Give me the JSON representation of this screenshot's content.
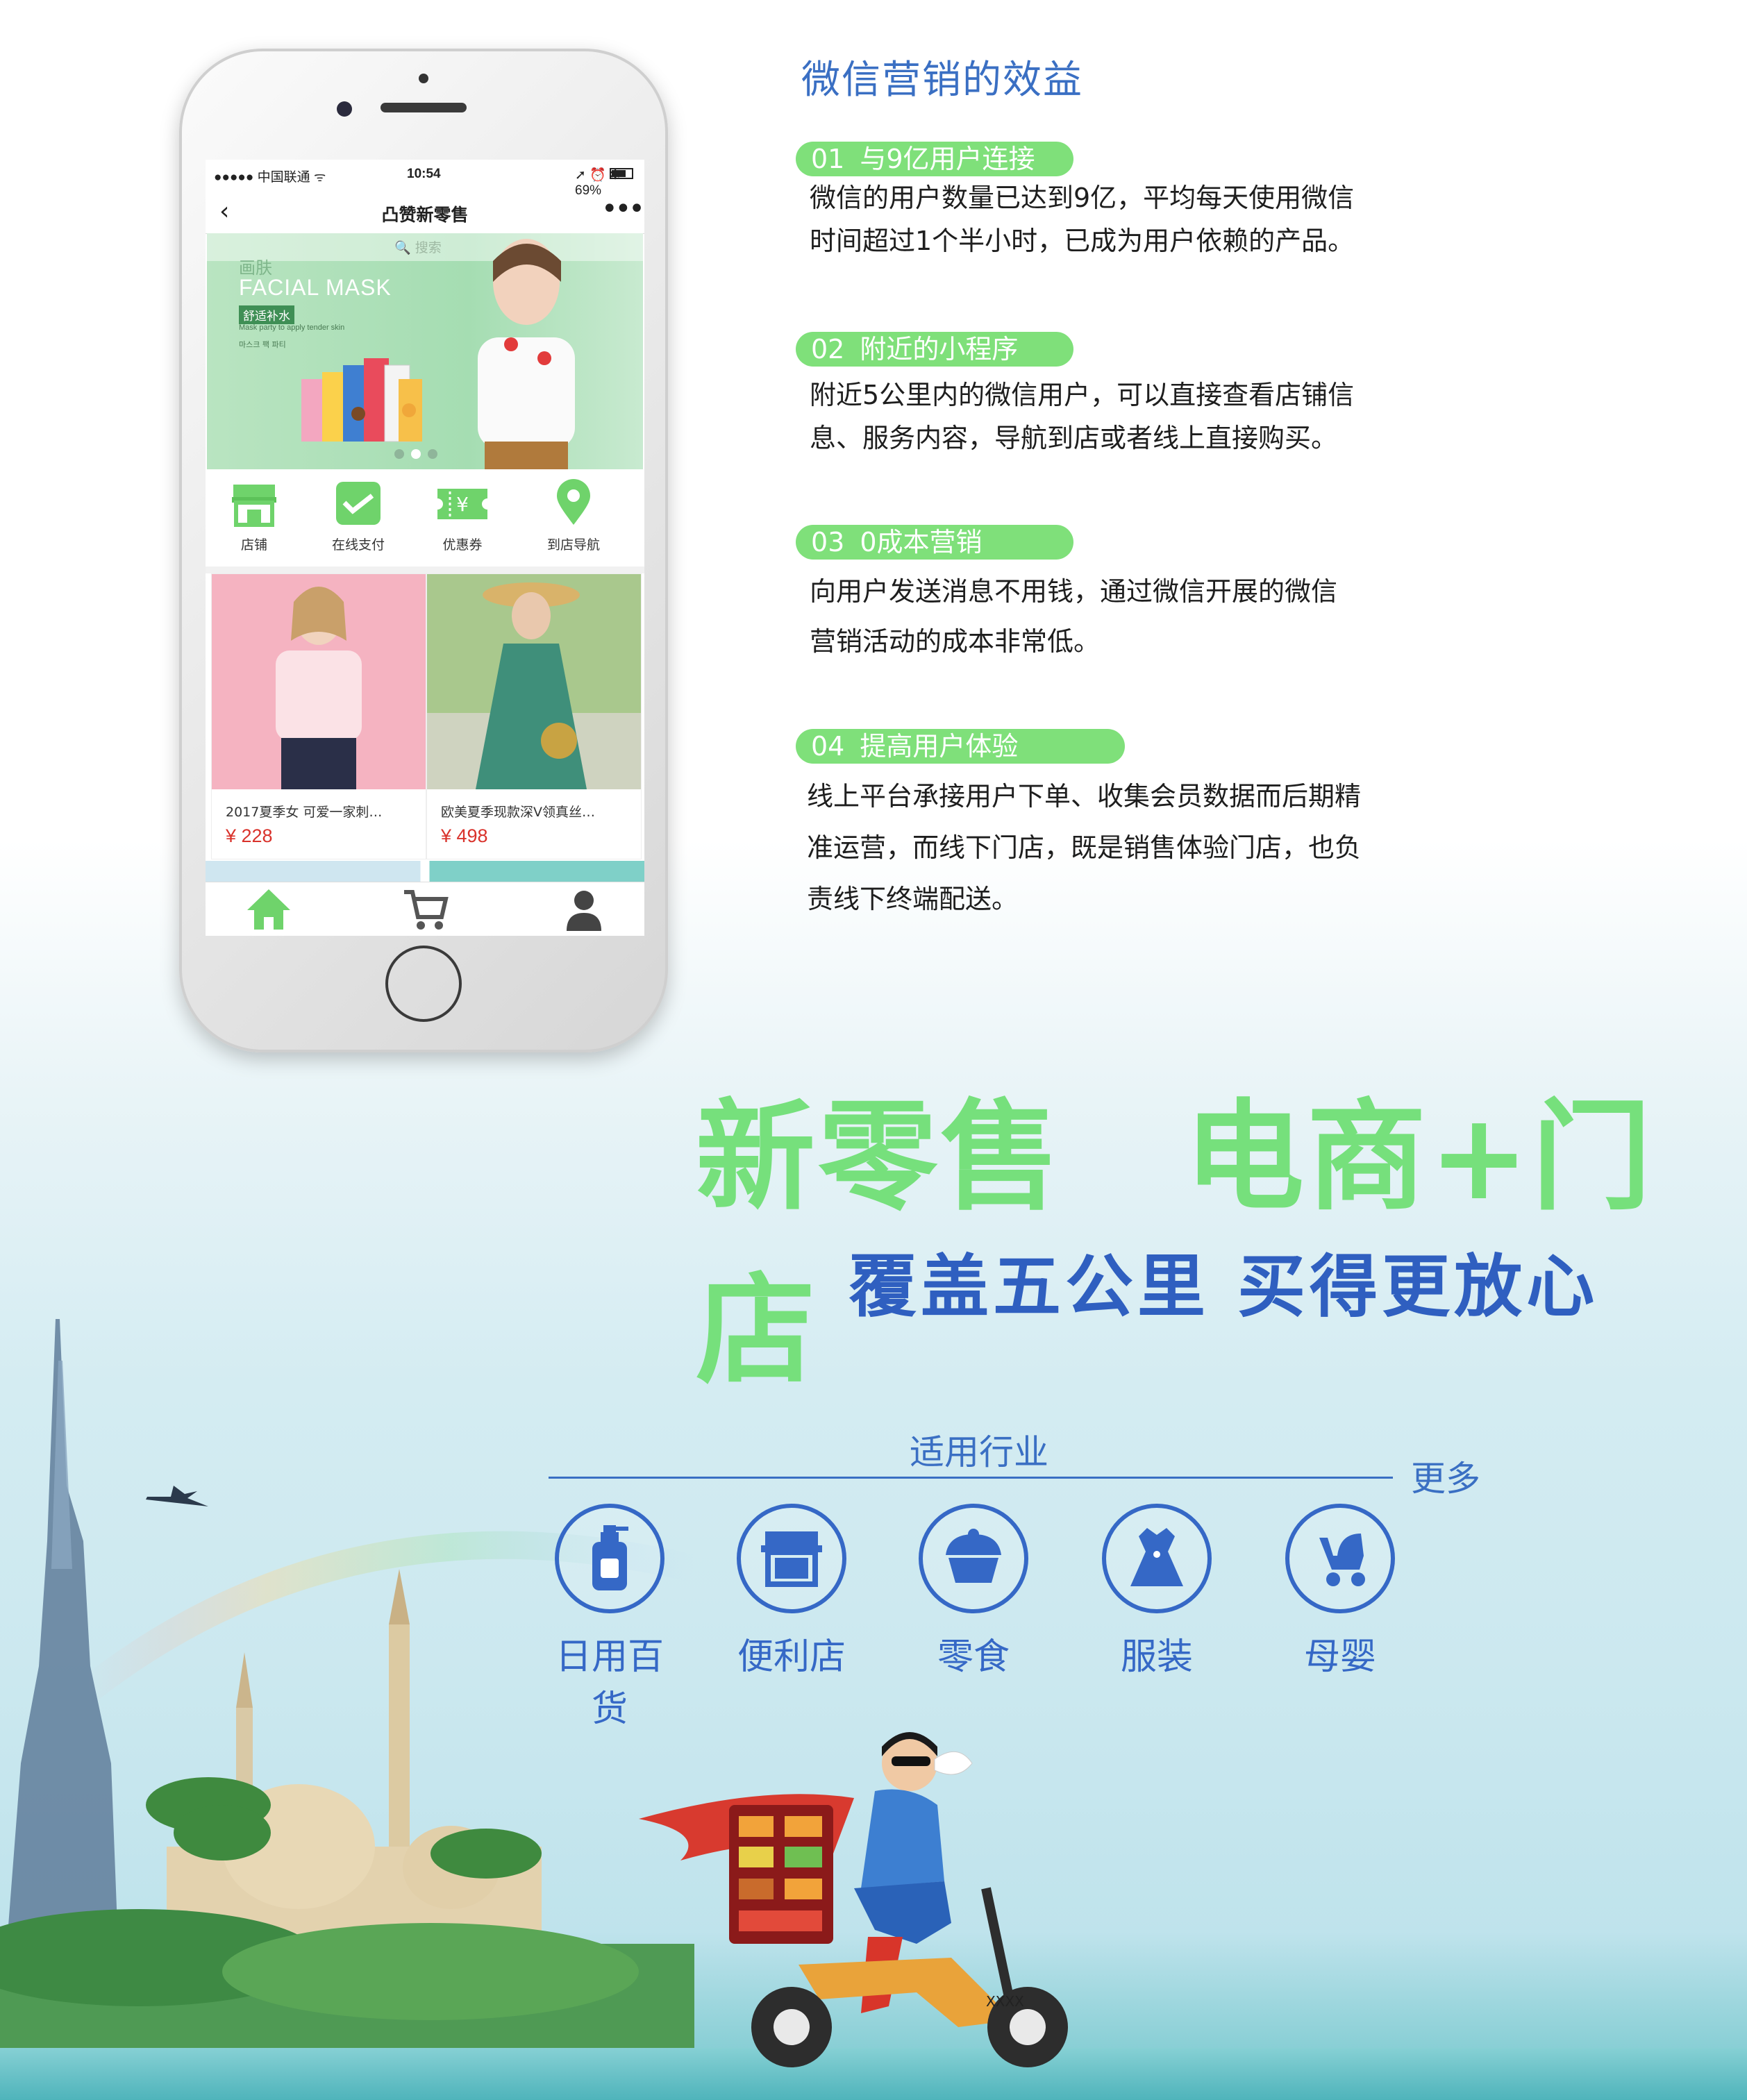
{
  "phone": {
    "status": {
      "carrier": "●●●●● 中国联通 ᯤ",
      "time": "10:54",
      "battery": "➚ ⏰ ✻ 69%"
    },
    "nav": {
      "title": "凸赞新零售",
      "back": "‹",
      "more": "•••"
    },
    "search_placeholder": "🔍 搜索",
    "banner": {
      "brand": "画肤",
      "title": "FACIAL MASK",
      "tag": "舒适补水",
      "sub": "Mask party to apply tender skin",
      "sub2": "마스크 팩 파티"
    },
    "quick_menu": [
      {
        "label": "店铺",
        "icon": "store-icon"
      },
      {
        "label": "在线支付",
        "icon": "wechat-pay-icon"
      },
      {
        "label": "优惠券",
        "icon": "coupon-icon"
      },
      {
        "label": "到店导航",
        "icon": "location-pin-icon"
      }
    ],
    "products": [
      {
        "title": "2017夏季女 可爱一家刺…",
        "price": "¥ 228"
      },
      {
        "title": "欧美夏季现款深V领真丝…",
        "price": "¥ 498"
      }
    ],
    "tabs": [
      "home-tab-icon",
      "cart-tab-icon",
      "profile-tab-icon"
    ],
    "accent": "#6fd36b"
  },
  "benefits": {
    "title": "微信营销的效益",
    "items": [
      {
        "num": "01",
        "title": "与9亿用户连接",
        "lines": [
          "微信的用户数量已达到9亿，平均每天使用微信",
          "时间超过1个半小时，已成为用户依赖的产品。"
        ]
      },
      {
        "num": "02",
        "title": "附近的小程序",
        "lines": [
          "附近5公里内的微信用户，可以直接查看店铺信",
          "息、服务内容，导航到店或者线上直接购买。"
        ]
      },
      {
        "num": "03",
        "title": "0成本营销",
        "lines": [
          "向用户发送消息不用钱，通过微信开展的微信",
          "营销活动的成本非常低。"
        ]
      },
      {
        "num": "04",
        "title": "提高用户体验",
        "lines": [
          "线上平台承接用户下单、收集会员数据而后期精",
          "准运营，而线下门店，既是销售体验门店，也负",
          "责线下终端配送。"
        ]
      }
    ]
  },
  "slogan": {
    "line1": "新零售　电商+门店",
    "line2": "覆盖五公里 买得更放心"
  },
  "industries": {
    "title": "适用行业",
    "more": "更多",
    "items": [
      {
        "label": "日用百货",
        "icon": "lotion-bottle-icon"
      },
      {
        "label": "便利店",
        "icon": "shop-icon"
      },
      {
        "label": "零食",
        "icon": "cupcake-icon"
      },
      {
        "label": "服装",
        "icon": "dress-icon"
      },
      {
        "label": "母婴",
        "icon": "stroller-icon"
      }
    ]
  },
  "hero_plate": "XXXX",
  "colors": {
    "green": "#76e07c",
    "blue": "#3568c6",
    "pill": "#7fe07a"
  }
}
